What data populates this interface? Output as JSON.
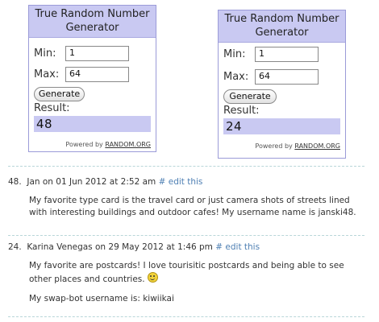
{
  "widgets": [
    {
      "title": "True Random Number Generator",
      "min_label": "Min:",
      "min_value": "1",
      "max_label": "Max:",
      "max_value": "64",
      "button_label": "Generate",
      "result_label": "Result:",
      "result_value": "48",
      "powered_by": "Powered by",
      "powered_link": "RANDOM.ORG"
    },
    {
      "title": "True Random Number Generator",
      "min_label": "Min:",
      "min_value": "1",
      "max_label": "Max:",
      "max_value": "64",
      "button_label": "Generate",
      "result_label": "Result:",
      "result_value": "24",
      "powered_by": "Powered by",
      "powered_link": "RANDOM.ORG"
    }
  ],
  "comments": [
    {
      "number": "48.",
      "author_date": "Jan on 01 Jun 2012 at 2:52 am",
      "edit_link": "# edit this",
      "paragraphs": [
        "My favorite type card is the travel card or just camera shots of streets lined with interesting buildings and outdoor cafes! My username name is janski48."
      ]
    },
    {
      "number": "24.",
      "author_date": "Karina Venegas on 29 May 2012 at 1:46 pm",
      "edit_link": "# edit this",
      "paragraphs": [
        "My favorite are postcards! I love tourisitic postcards and being able to see other places and countries.",
        "My swap-bot username is:  kiwiikai"
      ]
    }
  ],
  "colors": {
    "widget_header_bg": "#c9c9f2",
    "widget_border": "#9b9bd8",
    "edit_link": "#4e7fb3",
    "dashed_divider": "#b8d6d9"
  }
}
